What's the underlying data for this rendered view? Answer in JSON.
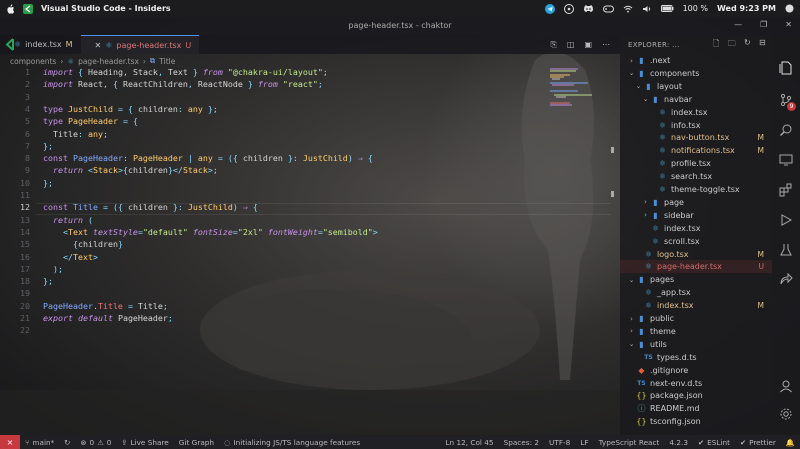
{
  "menubar": {
    "app_name": "Visual Studio Code - Insiders",
    "battery": "100 %",
    "datetime": "Wed 9:23 PM"
  },
  "window": {
    "title": "page-header.tsx - chaktor"
  },
  "tabs": [
    {
      "label": "index.tsx",
      "badge": "M"
    },
    {
      "label": "page-header.tsx",
      "badge": "U"
    }
  ],
  "breadcrumb": {
    "folder": "components",
    "file": "page-header.tsx",
    "symbol": "Title"
  },
  "editor": {
    "line_numbers": [
      "1",
      "2",
      "3",
      "4",
      "5",
      "6",
      "7",
      "8",
      "9",
      "10",
      "11",
      "12",
      "13",
      "14",
      "15",
      "16",
      "17",
      "18",
      "19",
      "20",
      "21",
      "22"
    ],
    "current_line": "12"
  },
  "explorer": {
    "header": "EXPLORER: ...",
    "items": [
      {
        "label": ".next",
        "kind": "folder",
        "open": false,
        "badge": ""
      },
      {
        "label": "components",
        "kind": "folder",
        "open": true,
        "badge": ""
      },
      {
        "label": "layout",
        "kind": "folder",
        "open": true,
        "badge": ""
      },
      {
        "label": "navbar",
        "kind": "folder",
        "open": true,
        "badge": ""
      },
      {
        "label": "index.tsx",
        "kind": "tsx",
        "badge": ""
      },
      {
        "label": "info.tsx",
        "kind": "tsx",
        "badge": ""
      },
      {
        "label": "nav-button.tsx",
        "kind": "tsx",
        "badge": "M"
      },
      {
        "label": "notifications.tsx",
        "kind": "tsx",
        "badge": "M"
      },
      {
        "label": "profile.tsx",
        "kind": "tsx",
        "badge": ""
      },
      {
        "label": "search.tsx",
        "kind": "tsx",
        "badge": ""
      },
      {
        "label": "theme-toggle.tsx",
        "kind": "tsx",
        "badge": ""
      },
      {
        "label": "page",
        "kind": "folder",
        "open": false,
        "badge": ""
      },
      {
        "label": "sidebar",
        "kind": "folder",
        "open": false,
        "badge": ""
      },
      {
        "label": "index.tsx",
        "kind": "tsx",
        "badge": ""
      },
      {
        "label": "scroll.tsx",
        "kind": "tsx",
        "badge": ""
      },
      {
        "label": "logo.tsx",
        "kind": "tsx",
        "badge": "M"
      },
      {
        "label": "page-header.tsx",
        "kind": "tsx",
        "badge": "U"
      },
      {
        "label": "pages",
        "kind": "folder",
        "open": true,
        "badge": ""
      },
      {
        "label": "_app.tsx",
        "kind": "tsx",
        "badge": ""
      },
      {
        "label": "index.tsx",
        "kind": "tsx",
        "badge": "M"
      },
      {
        "label": "public",
        "kind": "folder",
        "open": false,
        "badge": ""
      },
      {
        "label": "theme",
        "kind": "folder",
        "open": false,
        "badge": ""
      },
      {
        "label": "utils",
        "kind": "folder",
        "open": true,
        "badge": ""
      },
      {
        "label": "types.d.ts",
        "kind": "ts",
        "badge": ""
      },
      {
        "label": ".gitignore",
        "kind": "git",
        "badge": ""
      },
      {
        "label": "next-env.d.ts",
        "kind": "ts",
        "badge": ""
      },
      {
        "label": "package.json",
        "kind": "json",
        "badge": ""
      },
      {
        "label": "README.md",
        "kind": "md",
        "badge": ""
      },
      {
        "label": "tsconfig.json",
        "kind": "json",
        "badge": ""
      }
    ]
  },
  "activity_badge": "9",
  "status": {
    "branch": "main*",
    "errors": "0",
    "warnings": "0",
    "live_share": "Live Share",
    "git_graph": "Git Graph",
    "message": "Initializing JS/TS language features",
    "position": "Ln 12, Col 45",
    "spaces": "Spaces: 2",
    "encoding": "UTF-8",
    "eol": "LF",
    "language": "TypeScript React",
    "version": "4.2.3",
    "eslint": "ESLint",
    "prettier": "Prettier"
  },
  "colors": {
    "accent": "#4d90fe",
    "modified": "#e2c08d",
    "untracked": "#d46b6b",
    "remote": "#c5393f"
  }
}
